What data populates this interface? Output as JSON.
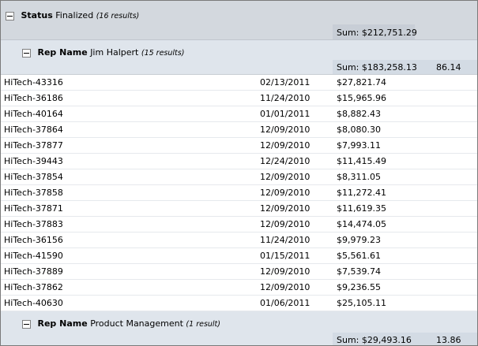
{
  "status_group": {
    "label": "Status",
    "value": "Finalized",
    "count": "(16 results)",
    "sum": "Sum: $212,751.29"
  },
  "rep_groups": [
    {
      "label": "Rep Name",
      "value": "Jim Halpert",
      "count": "(15 results)",
      "sum": "Sum: $183,258.13",
      "percent": "86.14",
      "rows": [
        {
          "id": "HiTech-43316",
          "date": "02/13/2011",
          "amount": "$27,821.74"
        },
        {
          "id": "HiTech-36186",
          "date": "11/24/2010",
          "amount": "$15,965.96"
        },
        {
          "id": "HiTech-40164",
          "date": "01/01/2011",
          "amount": "$8,882.43"
        },
        {
          "id": "HiTech-37864",
          "date": "12/09/2010",
          "amount": "$8,080.30"
        },
        {
          "id": "HiTech-37877",
          "date": "12/09/2010",
          "amount": "$7,993.11"
        },
        {
          "id": "HiTech-39443",
          "date": "12/24/2010",
          "amount": "$11,415.49"
        },
        {
          "id": "HiTech-37854",
          "date": "12/09/2010",
          "amount": "$8,311.05"
        },
        {
          "id": "HiTech-37858",
          "date": "12/09/2010",
          "amount": "$11,272.41"
        },
        {
          "id": "HiTech-37871",
          "date": "12/09/2010",
          "amount": "$11,619.35"
        },
        {
          "id": "HiTech-37883",
          "date": "12/09/2010",
          "amount": "$14,474.05"
        },
        {
          "id": "HiTech-36156",
          "date": "11/24/2010",
          "amount": "$9,979.23"
        },
        {
          "id": "HiTech-41590",
          "date": "01/15/2011",
          "amount": "$5,561.61"
        },
        {
          "id": "HiTech-37889",
          "date": "12/09/2010",
          "amount": "$7,539.74"
        },
        {
          "id": "HiTech-37862",
          "date": "12/09/2010",
          "amount": "$9,236.55"
        },
        {
          "id": "HiTech-40630",
          "date": "01/06/2011",
          "amount": "$25,105.11"
        }
      ]
    },
    {
      "label": "Rep Name",
      "value": "Product Management",
      "count": "(1 result)",
      "sum": "Sum: $29,493.16",
      "percent": "13.86",
      "rows": []
    }
  ]
}
